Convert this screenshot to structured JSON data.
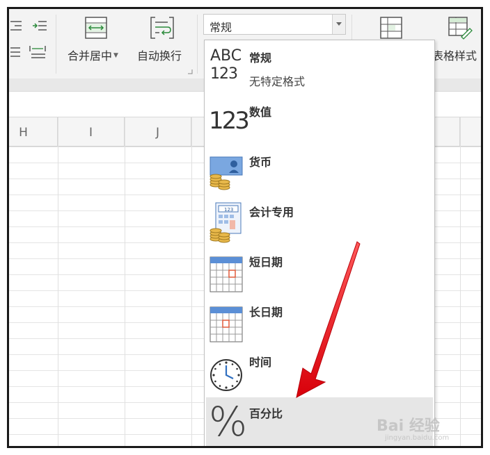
{
  "ribbon": {
    "merge_center_label": "合并居中",
    "auto_wrap_label": "自动换行",
    "table_style_label": "表格样式",
    "number_format_value": "常规"
  },
  "grid": {
    "columns": [
      "H",
      "I",
      "J"
    ]
  },
  "number_format_menu": {
    "items": [
      {
        "label": "常规",
        "description": "无特定格式",
        "icon": "abc-123-icon"
      },
      {
        "label": "数值",
        "icon": "number-123-icon"
      },
      {
        "label": "货币",
        "icon": "currency-coins-icon"
      },
      {
        "label": "会计专用",
        "icon": "accounting-calculator-icon"
      },
      {
        "label": "短日期",
        "icon": "calendar-icon"
      },
      {
        "label": "长日期",
        "icon": "calendar-icon"
      },
      {
        "label": "时间",
        "icon": "clock-icon"
      },
      {
        "label": "百分比",
        "icon": "percent-icon",
        "highlighted": true
      }
    ]
  },
  "icon_text": {
    "abc": "ABC",
    "n123": "123",
    "percent": "%"
  },
  "watermark": {
    "brand": "Bai  经验",
    "sub": "jingyan.baidu.com"
  },
  "colors": {
    "arrow": "#e8131c",
    "highlight": "#e6e6e6",
    "icon_blue": "#5b8fd6",
    "icon_red": "#e05a3a"
  }
}
